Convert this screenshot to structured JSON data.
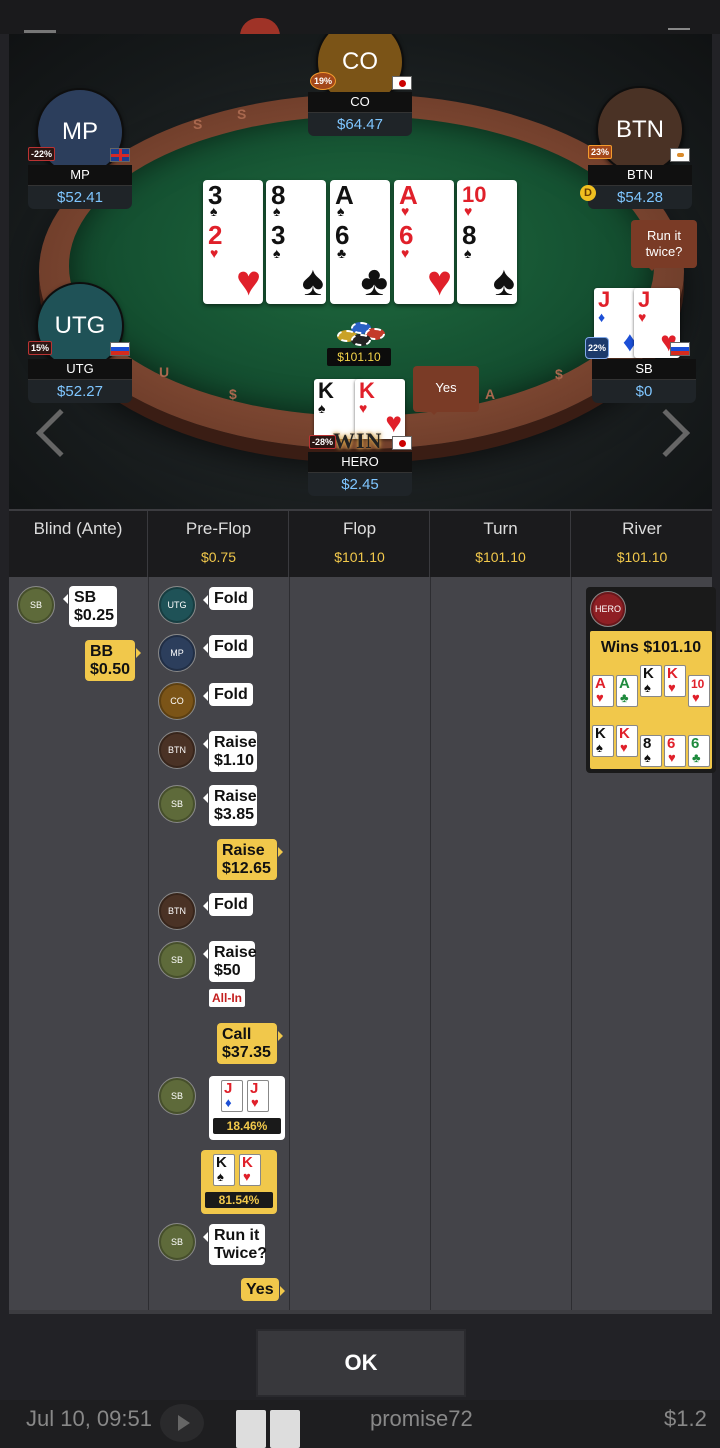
{
  "seats": {
    "co": {
      "abbr": "CO",
      "name": "CO",
      "stack": "$64.47",
      "pct": "19%"
    },
    "mp": {
      "abbr": "MP",
      "name": "MP",
      "stack": "$52.41",
      "pct": "-22%"
    },
    "btn": {
      "abbr": "BTN",
      "name": "BTN",
      "stack": "$54.28",
      "pct": "23%"
    },
    "utg": {
      "abbr": "UTG",
      "name": "UTG",
      "stack": "$52.27",
      "pct": "15%"
    },
    "sb": {
      "name": "SB",
      "stack": "$0",
      "pct": "22%"
    },
    "hero": {
      "name": "HERO",
      "stack": "$2.45",
      "pct": "-28%"
    }
  },
  "board": [
    {
      "top": "3",
      "bottom": "2",
      "top_suit": "♠",
      "bottom_suit": "♥"
    },
    {
      "top": "8",
      "bottom": "3",
      "top_suit": "♠",
      "bottom_suit": "♠"
    },
    {
      "top": "A",
      "bottom": "6",
      "top_suit": "♠",
      "bottom_suit": "♣"
    },
    {
      "top": "A",
      "bottom": "6",
      "top_suit": "♥",
      "bottom_suit": "♥"
    },
    {
      "top": "10",
      "bottom": "8",
      "top_suit": "♥",
      "bottom_suit": "♠"
    }
  ],
  "table": {
    "pot": "$101.10",
    "run_it_twice_bubble": "Run it twice?",
    "yes_bubble": "Yes",
    "win_text": "WIN",
    "dealer": "D",
    "rail_letters": [
      "S",
      "S",
      "U",
      "$",
      "$",
      "A",
      "$",
      "A",
      "S"
    ]
  },
  "sb_hole": [
    "J",
    "J"
  ],
  "hero_hole": [
    "K",
    "K"
  ],
  "streets": [
    {
      "name": "Blind (Ante)",
      "amount": ""
    },
    {
      "name": "Pre-Flop",
      "amount": "$0.75"
    },
    {
      "name": "Flop",
      "amount": "$101.10"
    },
    {
      "name": "Turn",
      "amount": "$101.10"
    },
    {
      "name": "River",
      "amount": "$101.10"
    }
  ],
  "actions": {
    "blind_sb_badge": "SB",
    "blind_sb": "SB $0.25",
    "blind_bb": "BB $0.50",
    "utg_badge": "UTG",
    "utg_fold": "Fold",
    "mp_badge": "MP",
    "mp_fold": "Fold",
    "co_badge": "CO",
    "co_fold": "Fold",
    "btn_badge": "BTN",
    "btn_raise": "Raise $1.10",
    "sb_badge1": "SB",
    "sb_raise": "Raise $3.85",
    "bb_raise": "Raise $12.65",
    "btn_badge2": "BTN",
    "btn_fold": "Fold",
    "sb_badge2": "SB",
    "sb_raise2": "Raise $50",
    "allin": "All-In",
    "bb_call": "Call $37.35",
    "sb_badge3": "SB",
    "sb_equity": "18.46%",
    "hero_equity": "81.54%",
    "sb_badge4": "SB",
    "sb_rit": "Run it Twice?",
    "hero_yes": "Yes"
  },
  "river": {
    "badge": "HERO",
    "wins": "Wins $101.10",
    "row1": [
      "A",
      "A",
      "K",
      "K",
      "10"
    ],
    "row2": [
      "K",
      "K",
      "8",
      "6",
      "6"
    ]
  },
  "ok_label": "OK",
  "footer": {
    "date": "Jul 10, 09:51",
    "player": "promise72",
    "amount": "$1.2"
  },
  "colors": {
    "accent_yellow": "#f1c84b",
    "stack_blue": "#7fc6ff",
    "felt_green": "#1f6a3e",
    "rail_brown": "#7a4530"
  },
  "icons": {
    "play": "play-icon",
    "prev": "chevron-left-icon",
    "next": "chevron-right-icon",
    "dealer": "dealer-button-icon"
  }
}
